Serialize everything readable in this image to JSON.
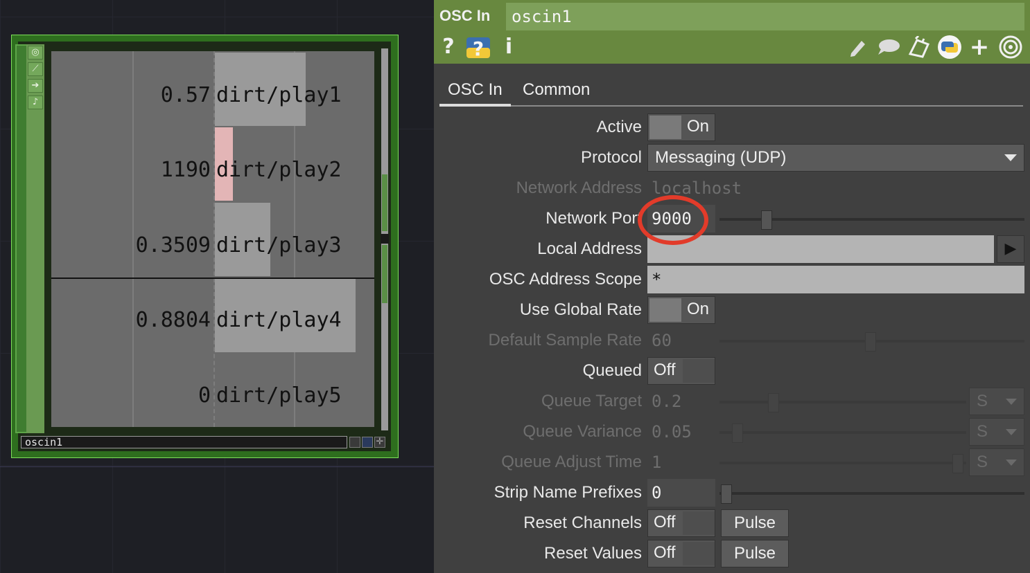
{
  "node": {
    "name": "oscin1",
    "channels": [
      {
        "value": "0.57",
        "name": "dirt/play1"
      },
      {
        "value": "1190",
        "name": "dirt/play2"
      },
      {
        "value": "0.3509",
        "name": "dirt/play3"
      },
      {
        "value": "0.8804",
        "name": "dirt/play4"
      },
      {
        "value": "0",
        "name": "dirt/play5"
      }
    ]
  },
  "panel": {
    "op_type": "OSC In",
    "op_name": "oscin1",
    "tabs": [
      "OSC In",
      "Common"
    ],
    "active_tab": "OSC In",
    "params": {
      "active": {
        "label": "Active",
        "value": "On"
      },
      "protocol": {
        "label": "Protocol",
        "value": "Messaging (UDP)"
      },
      "network_address": {
        "label": "Network Address",
        "value": "localhost"
      },
      "network_port": {
        "label": "Network Port",
        "value": "9000"
      },
      "local_address": {
        "label": "Local Address",
        "value": ""
      },
      "osc_address_scope": {
        "label": "OSC Address Scope",
        "value": "*"
      },
      "use_global_rate": {
        "label": "Use Global Rate",
        "value": "On"
      },
      "default_sample_rate": {
        "label": "Default Sample Rate",
        "value": "60"
      },
      "queued": {
        "label": "Queued",
        "value": "Off"
      },
      "queue_target": {
        "label": "Queue Target",
        "value": "0.2",
        "unit": "S"
      },
      "queue_variance": {
        "label": "Queue Variance",
        "value": "0.05",
        "unit": "S"
      },
      "queue_adjust_time": {
        "label": "Queue Adjust Time",
        "value": "1",
        "unit": "S"
      },
      "strip_name_prefixes": {
        "label": "Strip Name Prefixes",
        "value": "0"
      },
      "reset_channels": {
        "label": "Reset Channels",
        "value": "Off",
        "button": "Pulse"
      },
      "reset_values": {
        "label": "Reset Values",
        "value": "Off",
        "button": "Pulse"
      }
    }
  },
  "icons": {
    "help": "help-icon",
    "python_help": "python-help-icon",
    "info": "info-icon",
    "edit": "pencil-icon",
    "comment": "comment-icon",
    "clone": "clone-icon",
    "python": "python-icon",
    "add": "plus-icon",
    "viewer": "target-icon"
  },
  "colors": {
    "header_green": "#68883f",
    "node_border": "#7ee05a",
    "annotation_red": "#e23b2a"
  }
}
